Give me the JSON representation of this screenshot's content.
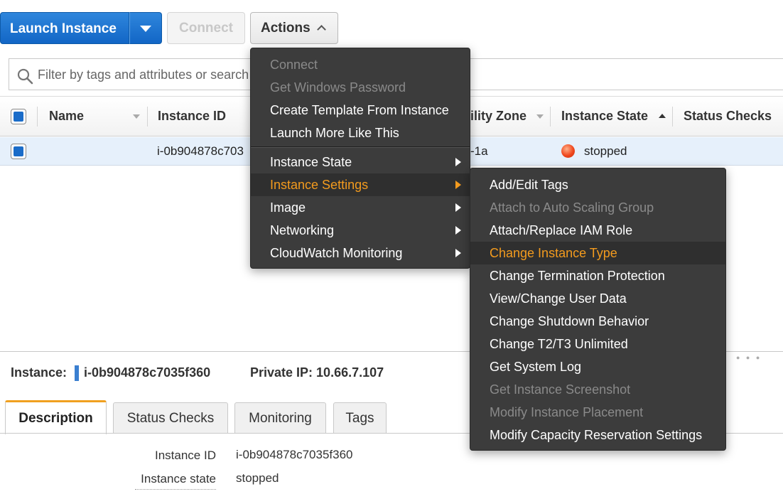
{
  "toolbar": {
    "launch_label": "Launch Instance",
    "connect_label": "Connect",
    "actions_label": "Actions"
  },
  "filter": {
    "placeholder": "Filter by tags and attributes or search"
  },
  "table": {
    "columns": [
      "Name",
      "Instance ID",
      "ility Zone",
      "Instance State",
      "Status Checks"
    ],
    "rows": [
      {
        "name": "",
        "instance_id": "i-0b904878c703",
        "zone": "-1a",
        "state": "stopped",
        "state_color": "#e8431c"
      }
    ]
  },
  "actions_menu": {
    "items": [
      {
        "label": "Connect",
        "disabled": true
      },
      {
        "label": "Get Windows Password",
        "disabled": true
      },
      {
        "label": "Create Template From Instance",
        "disabled": false
      },
      {
        "label": "Launch More Like This",
        "disabled": false
      },
      {
        "label": "Instance State",
        "submenu": true
      },
      {
        "label": "Instance Settings",
        "submenu": true,
        "highlighted": true
      },
      {
        "label": "Image",
        "submenu": true
      },
      {
        "label": "Networking",
        "submenu": true
      },
      {
        "label": "CloudWatch Monitoring",
        "submenu": true
      }
    ]
  },
  "settings_menu": {
    "items": [
      {
        "label": "Add/Edit Tags",
        "disabled": false
      },
      {
        "label": "Attach to Auto Scaling Group",
        "disabled": true
      },
      {
        "label": "Attach/Replace IAM Role",
        "disabled": false
      },
      {
        "label": "Change Instance Type",
        "highlighted": true
      },
      {
        "label": "Change Termination Protection",
        "disabled": false
      },
      {
        "label": "View/Change User Data",
        "disabled": false
      },
      {
        "label": "Change Shutdown Behavior",
        "disabled": false
      },
      {
        "label": "Change T2/T3 Unlimited",
        "disabled": false
      },
      {
        "label": "Get System Log",
        "disabled": false
      },
      {
        "label": "Get Instance Screenshot",
        "disabled": true
      },
      {
        "label": "Modify Instance Placement",
        "disabled": true
      },
      {
        "label": "Modify Capacity Reservation Settings",
        "disabled": false
      }
    ]
  },
  "detail": {
    "instance_label": "Instance:",
    "instance_value": "i-0b904878c7035f360",
    "private_ip": "Private IP: 10.66.7.107",
    "tabs": [
      "Description",
      "Status Checks",
      "Monitoring",
      "Tags"
    ],
    "fields": [
      {
        "label": "Instance ID",
        "value": "i-0b904878c7035f360"
      },
      {
        "label": "Instance state",
        "value": "stopped"
      }
    ]
  },
  "colors": {
    "primary_blue": "#1a6cc9",
    "menu_highlight": "#f39b1e",
    "active_tab_accent": "#f0a020"
  }
}
